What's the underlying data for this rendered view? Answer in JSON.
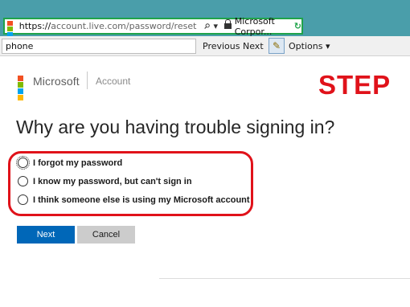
{
  "browser": {
    "url_protocol": "https://",
    "url_rest": "account.live.com/password/reset",
    "search_icon": "search-icon",
    "dropdown_glyph": "▾",
    "cert_name": "Microsoft Corpor...",
    "refresh_glyph": "↻",
    "border_color": "#1fa34a"
  },
  "findbar": {
    "query": "phone",
    "prev_label": "Previous",
    "next_label": "Next",
    "options_label": "Options ▾"
  },
  "header": {
    "brand": "Microsoft",
    "section": "Account",
    "logo_colors": [
      "#f25022",
      "#7fba00",
      "#00a4ef",
      "#ffb900"
    ]
  },
  "annotation": {
    "label": "STEP",
    "color": "#e0121a"
  },
  "page": {
    "title": "Why are you having trouble signing in?"
  },
  "options": [
    {
      "label": "I forgot my password"
    },
    {
      "label": "I know my password, but can't sign in"
    },
    {
      "label": "I think someone else is using my Microsoft account"
    }
  ],
  "buttons": {
    "next": "Next",
    "cancel": "Cancel",
    "accent": "#0067b8"
  }
}
